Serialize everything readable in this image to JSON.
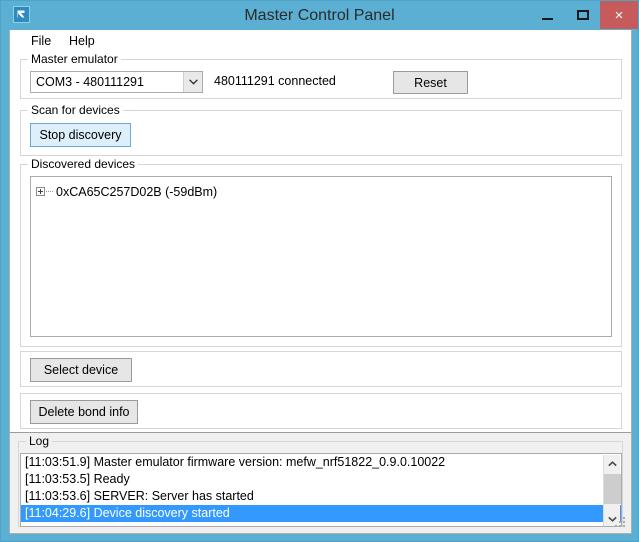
{
  "window": {
    "title": "Master Control Panel",
    "icon": "app-icon",
    "controls": {
      "minimize": "minimize-icon",
      "maximize": "maximize-icon",
      "close": "×"
    }
  },
  "menubar": {
    "items": [
      {
        "label": "File"
      },
      {
        "label": "Help"
      }
    ]
  },
  "master_emulator": {
    "group_label": "Master emulator",
    "port_select": {
      "value": "COM3 - 480111291",
      "arrow": "chevron-down-icon"
    },
    "status": "480111291 connected",
    "reset_button": "Reset"
  },
  "scan_for_devices": {
    "group_label": "Scan for devices",
    "discovery_button": "Stop discovery"
  },
  "discovered_devices": {
    "group_label": "Discovered devices",
    "items": [
      {
        "expander": "plus-box-icon",
        "label": "0xCA65C257D02B (-59dBm)"
      }
    ]
  },
  "select_device": {
    "button": "Select device"
  },
  "delete_bond": {
    "button": "Delete bond info"
  },
  "log": {
    "group_label": "Log",
    "entries": [
      {
        "text": "[11:03:51.9] Master emulator firmware version: mefw_nrf51822_0.9.0.10022",
        "selected": false
      },
      {
        "text": "[11:03:53.5] Ready",
        "selected": false
      },
      {
        "text": "[11:03:53.6] SERVER: Server has started",
        "selected": false
      },
      {
        "text": "[11:04:29.6] Device discovery started",
        "selected": true
      }
    ],
    "scrollbar": {
      "up_arrow": "scroll-up-icon",
      "down_arrow": "scroll-down-icon"
    }
  },
  "colors": {
    "window_frame": "#5BAFD2",
    "close_button": "#C75B5B",
    "selection": "#3399FF",
    "panel_gray": "#F0F0F0",
    "button_face": "#E6E6E6",
    "button_hover": "#DDEFFA"
  }
}
